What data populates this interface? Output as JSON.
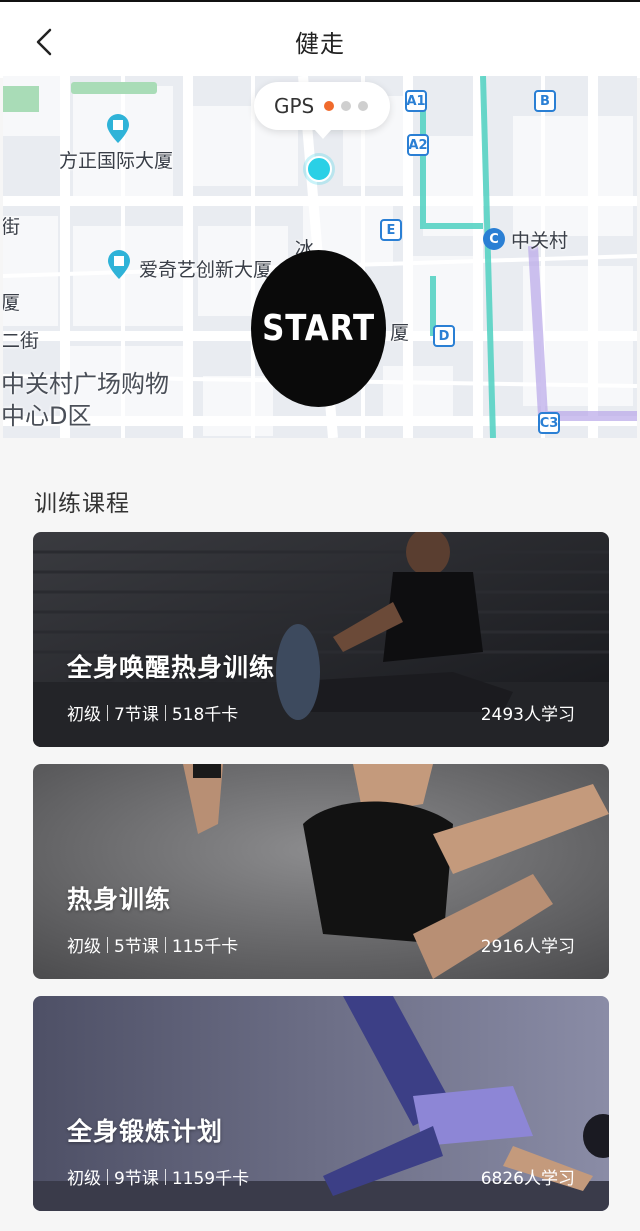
{
  "header": {
    "title": "健走",
    "back_icon": "chevron-left-icon"
  },
  "map": {
    "gps_label": "GPS",
    "gps_dots": [
      "#f06a2c",
      "#cfcfcf",
      "#cfcfcf"
    ],
    "start_label": "START",
    "pois": {
      "fangzheng": "方正国际大厦",
      "iqiyi": "爱奇艺创新大厦",
      "zgc_mall": "中关村广场购物中心D区",
      "zgc_metro": "中关村",
      "bing": "冰",
      "sha": "厦",
      "jie": "街",
      "jie2": "二街",
      "sha2": "厦"
    },
    "badges": {
      "a1": "A1",
      "a2": "A2",
      "b": "B",
      "e": "E",
      "d": "D",
      "c3": "C3",
      "metro": "C"
    },
    "accent": "#2ad0e6"
  },
  "training": {
    "section_title": "训练课程",
    "courses": [
      {
        "title": "全身唤醒热身训练",
        "level": "初级",
        "lessons": "7节课",
        "calories": "518千卡",
        "learners": "2493人学习"
      },
      {
        "title": "热身训练",
        "level": "初级",
        "lessons": "5节课",
        "calories": "115千卡",
        "learners": "2916人学习"
      },
      {
        "title": "全身锻炼计划",
        "level": "初级",
        "lessons": "9节课",
        "calories": "1159千卡",
        "learners": "6826人学习"
      }
    ]
  }
}
